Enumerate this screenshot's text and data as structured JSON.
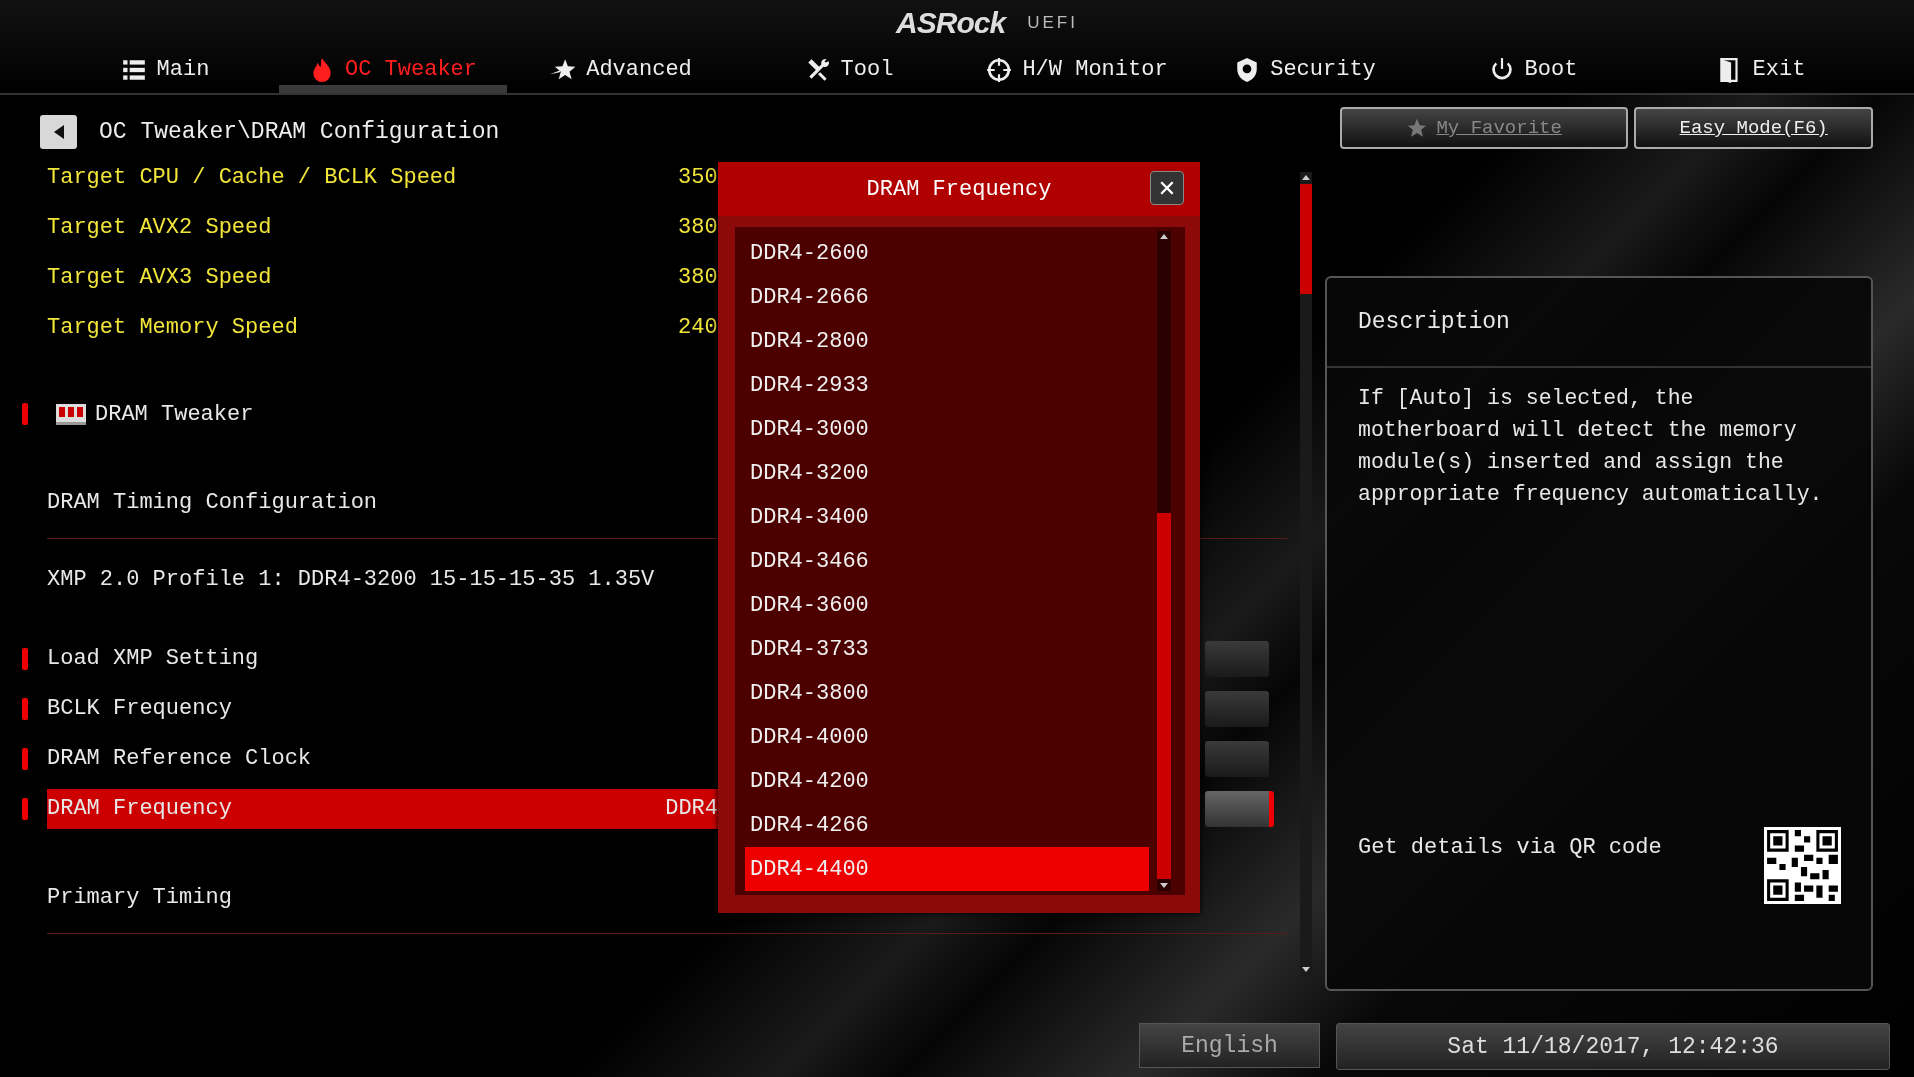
{
  "header": {
    "logo": "ASRock",
    "logo_suffix": "UEFI"
  },
  "tabs": [
    {
      "label": "Main",
      "selected": false
    },
    {
      "label": "OC Tweaker",
      "selected": true
    },
    {
      "label": "Advanced",
      "selected": false
    },
    {
      "label": "Tool",
      "selected": false
    },
    {
      "label": "H/W Monitor",
      "selected": false
    },
    {
      "label": "Security",
      "selected": false
    },
    {
      "label": "Boot",
      "selected": false
    },
    {
      "label": "Exit",
      "selected": false
    }
  ],
  "breadcrumb": "OC Tweaker\\DRAM Configuration",
  "top_buttons": [
    {
      "label": "My Favorite",
      "kind": "favorite"
    },
    {
      "label": "Easy Mode(F6)",
      "kind": "plain"
    }
  ],
  "settings": [
    {
      "kind": "info",
      "label": "Target CPU / Cache / BCLK Speed",
      "value": "350"
    },
    {
      "kind": "info",
      "label": "Target AVX2 Speed",
      "value": "380"
    },
    {
      "kind": "info",
      "label": "Target AVX3 Speed",
      "value": "380"
    },
    {
      "kind": "info",
      "label": "Target Memory Speed",
      "value": "240"
    },
    {
      "kind": "section",
      "label": "DRAM Tweaker"
    },
    {
      "kind": "submenu",
      "label": "DRAM Timing Configuration"
    },
    {
      "kind": "text",
      "label": "XMP 2.0 Profile 1: DDR4-3200 15-15-15-35 1.35V"
    },
    {
      "kind": "option",
      "label": "Load XMP Setting",
      "selected": false
    },
    {
      "kind": "option",
      "label": "BCLK Frequency",
      "selected": false
    },
    {
      "kind": "option",
      "label": "DRAM Reference Clock",
      "selected": false
    },
    {
      "kind": "option",
      "label": "DRAM Frequency",
      "value": "DDR4",
      "selected": true
    },
    {
      "kind": "submenu",
      "label": "Primary Timing"
    }
  ],
  "dialog": {
    "title": "DRAM Frequency",
    "close": "✕",
    "options": [
      {
        "label": "DDR4-2600",
        "selected": false
      },
      {
        "label": "DDR4-2666",
        "selected": false
      },
      {
        "label": "DDR4-2800",
        "selected": false
      },
      {
        "label": "DDR4-2933",
        "selected": false
      },
      {
        "label": "DDR4-3000",
        "selected": false
      },
      {
        "label": "DDR4-3200",
        "selected": false
      },
      {
        "label": "DDR4-3400",
        "selected": false
      },
      {
        "label": "DDR4-3466",
        "selected": false
      },
      {
        "label": "DDR4-3600",
        "selected": false
      },
      {
        "label": "DDR4-3733",
        "selected": false
      },
      {
        "label": "DDR4-3800",
        "selected": false
      },
      {
        "label": "DDR4-4000",
        "selected": false
      },
      {
        "label": "DDR4-4200",
        "selected": false
      },
      {
        "label": "DDR4-4266",
        "selected": false
      },
      {
        "label": "DDR4-4400",
        "selected": true
      }
    ]
  },
  "description": {
    "title": "Description",
    "text": "If [Auto] is selected, the\nmotherboard will detect the memory\nmodule(s) inserted and assign the\nappropriate frequency automatically.",
    "qr_label": "Get details via QR code"
  },
  "status_bar": {
    "language": "English",
    "datetime": "Sat 11/18/2017, 12:42:36"
  }
}
